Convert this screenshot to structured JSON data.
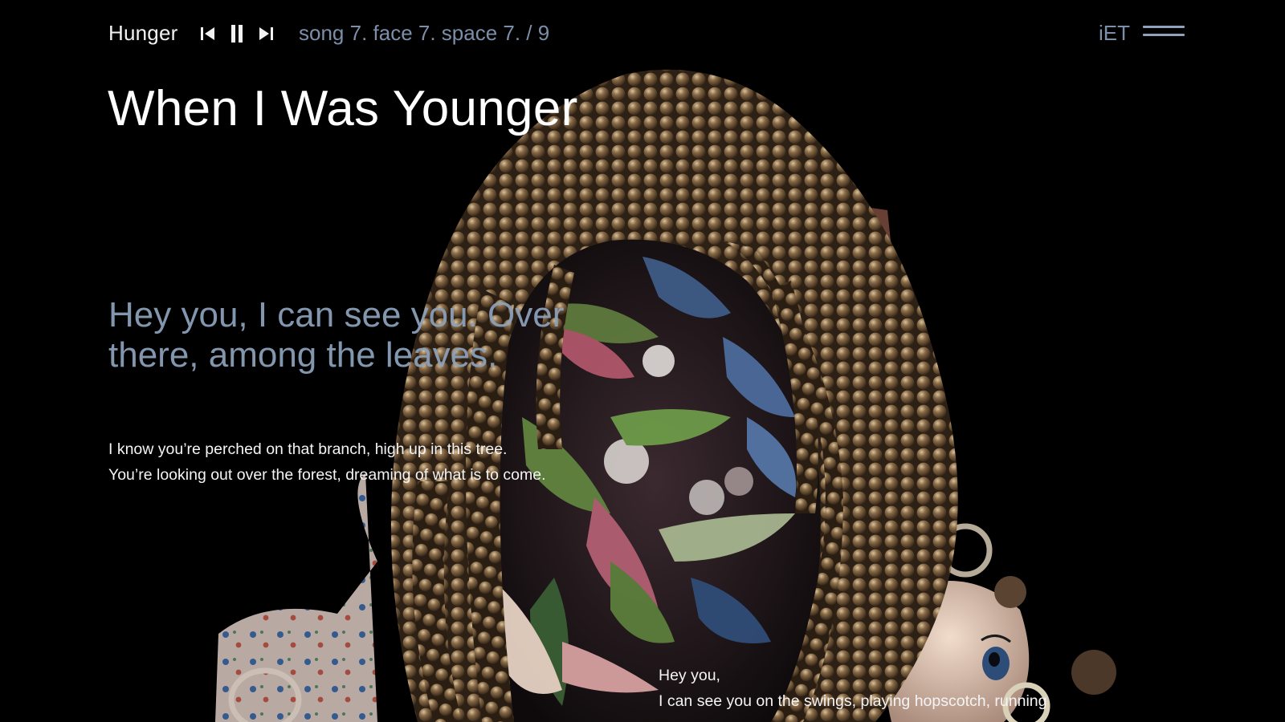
{
  "player": {
    "track_name": "Hunger",
    "location": "song 7. face 7. space 7. / 9",
    "prev_icon": "skip-previous-icon",
    "pause_icon": "pause-icon",
    "next_icon": "skip-next-icon"
  },
  "brand": {
    "label": "iET",
    "menu_icon": "hamburger-menu-icon"
  },
  "page": {
    "title": "When I Was Younger",
    "lead": "Hey you, I can see you. Over there, among the leaves.",
    "body_lines": [
      "I know you’re perched on that branch, high up in this tree.",
      "You’re looking out over the forest, dreaming of what is to come."
    ],
    "bottom_lines": [
      "Hey you,",
      "I can see you on the swings, playing hopscotch, running"
    ]
  },
  "colors": {
    "background": "#000000",
    "accent": "#7b8fa8",
    "braid": "#6b5236",
    "text": "#f4f4f4"
  }
}
